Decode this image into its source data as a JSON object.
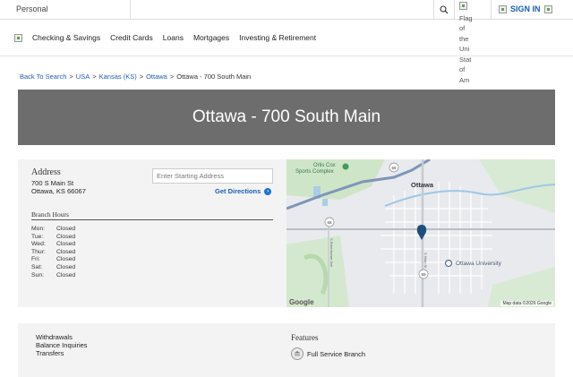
{
  "topbar": {
    "segment": "Personal",
    "flag_alt": [
      "Flag",
      "of",
      "the",
      "Uni",
      "Stat",
      "of",
      "Am"
    ],
    "signin_label": "SIGN IN"
  },
  "nav": {
    "items": [
      "Checking & Savings",
      "Credit Cards",
      "Loans",
      "Mortgages",
      "Investing & Retirement"
    ]
  },
  "breadcrumb": {
    "items": [
      "Back To Search",
      "USA",
      "Kansas (KS)",
      "Ottawa",
      "Ottawa - 700 South Main"
    ],
    "separator": ">"
  },
  "hero": {
    "title": "Ottawa - 700 South Main"
  },
  "address": {
    "title": "Address",
    "line1": "700 S Main St",
    "line2": "Ottawa, KS 66067",
    "start_placeholder": "Enter Starting Address",
    "directions_label": "Get Directions"
  },
  "hours": {
    "title": "Branch Hours",
    "rows": [
      {
        "day": "Mon:",
        "value": "Closed"
      },
      {
        "day": "Tue:",
        "value": "Closed"
      },
      {
        "day": "Wed:",
        "value": "Closed"
      },
      {
        "day": "Thur:",
        "value": "Closed"
      },
      {
        "day": "Fri:",
        "value": "Closed"
      },
      {
        "day": "Sat:",
        "value": "Closed"
      },
      {
        "day": "Sun:",
        "value": "Closed"
      }
    ]
  },
  "map": {
    "labels": {
      "poi1a": "Orlis Cox",
      "poi1b": "Sports Complex",
      "city": "Ottawa",
      "university": "Ottawa University",
      "road_main": "S Main St",
      "road_eisenhower": "S Eisenhower Ave",
      "route_59a": "59",
      "route_59b": "59",
      "route_68": "68"
    },
    "attribution": "Map data ©2026 Google",
    "logo": "Google"
  },
  "services": {
    "items": [
      "Withdrawals",
      "Balance Inquiries",
      "Transfers"
    ]
  },
  "features": {
    "title": "Features",
    "items": [
      "Full Service Branch"
    ]
  }
}
